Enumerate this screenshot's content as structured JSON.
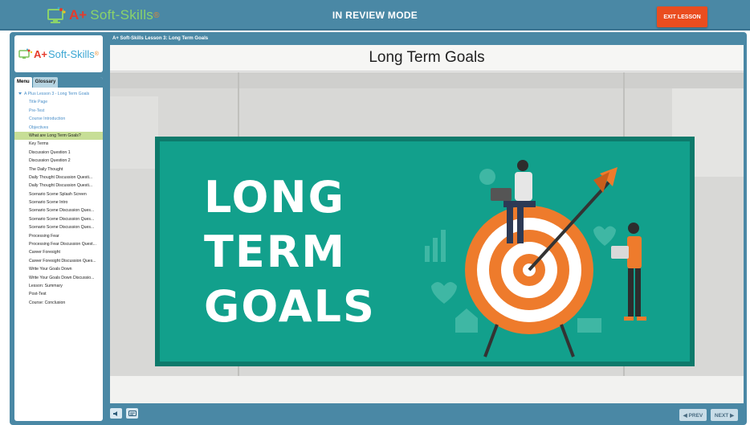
{
  "header": {
    "logo_aplus": "A+",
    "logo_soft": "Soft-Skills",
    "logo_reg": "®",
    "mode_title": "IN REVIEW MODE",
    "exit_label": "EXIT LESSON"
  },
  "sidebar": {
    "logo_aplus": "A+",
    "logo_soft": "Soft-Skills",
    "logo_reg": "®",
    "tabs": [
      "Menu",
      "Glossary"
    ],
    "root_item": "A Plus Lesson 3 - Long Term Goals",
    "items": [
      {
        "label": "Title Page",
        "style": "blue"
      },
      {
        "label": "Pre-Test",
        "style": "blue"
      },
      {
        "label": "Course Introduction",
        "style": "blue"
      },
      {
        "label": "Objectives",
        "style": "blue"
      },
      {
        "label": "What are Long Term Goals?",
        "style": "active"
      },
      {
        "label": "Key Terms",
        "style": "normal"
      },
      {
        "label": "Discussion Question 1",
        "style": "normal"
      },
      {
        "label": "Discussion Question 2",
        "style": "normal"
      },
      {
        "label": "The Daily Thought",
        "style": "normal"
      },
      {
        "label": "Daily Thought Discussion Questi...",
        "style": "normal"
      },
      {
        "label": "Daily Thought Discussion Questi...",
        "style": "normal"
      },
      {
        "label": "Scenario Scene Splash Screen",
        "style": "normal"
      },
      {
        "label": "Scenario Scene Intro",
        "style": "normal"
      },
      {
        "label": "Scenario Scene Discussion Ques...",
        "style": "normal"
      },
      {
        "label": "Scenario Scene Discussion Ques...",
        "style": "normal"
      },
      {
        "label": "Scenario Scene Discussion Ques...",
        "style": "normal"
      },
      {
        "label": "Processing Fear",
        "style": "normal"
      },
      {
        "label": "Processing Fear Discussion Quest...",
        "style": "normal"
      },
      {
        "label": "Career Foresight",
        "style": "normal"
      },
      {
        "label": "Career Foresight Discussion Ques...",
        "style": "normal"
      },
      {
        "label": "Write Your Goals Down",
        "style": "normal"
      },
      {
        "label": "Write Your Goals Down Discussio...",
        "style": "normal"
      },
      {
        "label": "Lesson: Summary",
        "style": "normal"
      },
      {
        "label": "Post-Test",
        "style": "normal"
      },
      {
        "label": "Course: Conclusion",
        "style": "normal"
      }
    ]
  },
  "content": {
    "lesson_title": "A+ Soft-Skills Lesson 3: Long Term Goals",
    "slide_title": "Long Term Goals",
    "poster_lines": [
      "LONG",
      "TERM",
      "GOALS"
    ]
  },
  "controls": {
    "prev_label": "◀ PREV",
    "next_label": "NEXT ▶"
  },
  "colors": {
    "accent": "#4a88a5",
    "exit": "#ea4d1f",
    "poster": "#12a08c",
    "active_item": "#c7de96"
  }
}
